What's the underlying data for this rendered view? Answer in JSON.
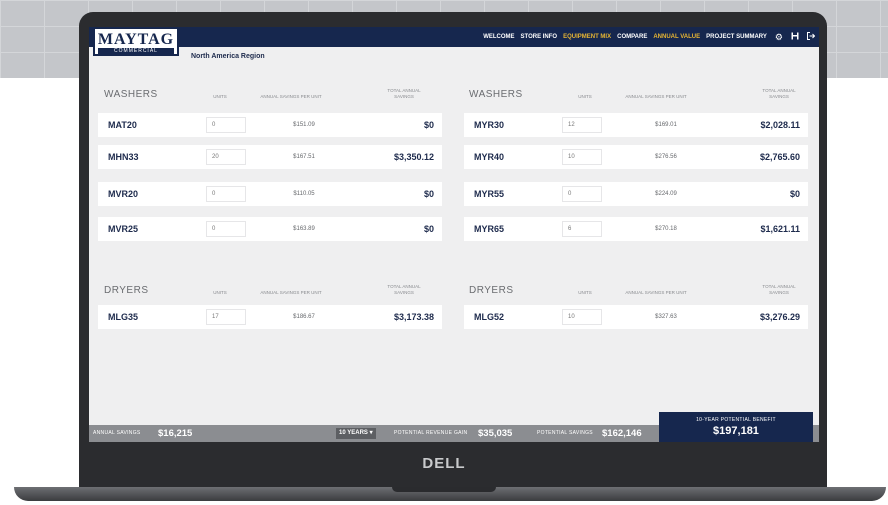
{
  "brand": {
    "name": "MAYTAG",
    "sub": "COMMERCIAL",
    "laptop": "DELL"
  },
  "nav": {
    "items": [
      {
        "label": "WELCOME"
      },
      {
        "label": "STORE INFO"
      },
      {
        "label": "EQUIPMENT MIX",
        "active": true
      },
      {
        "label": "COMPARE"
      },
      {
        "label": "ANNUAL VALUE",
        "active": true
      },
      {
        "label": "PROJECT SUMMARY"
      }
    ],
    "icons": [
      "gear-icon",
      "save-icon",
      "logout-icon"
    ]
  },
  "region": "North America Region",
  "headers": {
    "washers": "WASHERS",
    "dryers": "DRYERS",
    "units": "UNITS",
    "per_unit": "ANNUAL SAVINGS PER UNIT",
    "total": "TOTAL ANNUAL SAVINGS"
  },
  "washers_left": [
    {
      "model": "MAT20",
      "units": "0",
      "per_unit": "$151.09",
      "total": "$0"
    },
    {
      "model": "MHN33",
      "units": "20",
      "per_unit": "$167.51",
      "total": "$3,350.12"
    },
    {
      "model": "MVR20",
      "units": "0",
      "per_unit": "$110.05",
      "total": "$0"
    },
    {
      "model": "MVR25",
      "units": "0",
      "per_unit": "$163.89",
      "total": "$0"
    }
  ],
  "washers_right": [
    {
      "model": "MYR30",
      "units": "12",
      "per_unit": "$169.01",
      "total": "$2,028.11"
    },
    {
      "model": "MYR40",
      "units": "10",
      "per_unit": "$276.56",
      "total": "$2,765.60"
    },
    {
      "model": "MYR55",
      "units": "0",
      "per_unit": "$224.09",
      "total": "$0"
    },
    {
      "model": "MYR65",
      "units": "6",
      "per_unit": "$270.18",
      "total": "$1,621.11"
    }
  ],
  "dryers_left": [
    {
      "model": "MLG35",
      "units": "17",
      "per_unit": "$186.67",
      "total": "$3,173.38"
    }
  ],
  "dryers_right": [
    {
      "model": "MLG52",
      "units": "10",
      "per_unit": "$327.63",
      "total": "$3,276.29"
    }
  ],
  "footer": {
    "annual_label": "ANNUAL SAVINGS",
    "annual_value": "$16,215",
    "period": "10 YEARS",
    "revenue_label": "POTENTIAL REVENUE GAIN",
    "revenue_value": "$35,035",
    "savings_label": "POTENTIAL SAVINGS",
    "savings_value": "$162,146",
    "benefit_label": "10-YEAR POTENTIAL BENEFIT",
    "benefit_value": "$197,181"
  },
  "colors": {
    "navy": "#16274e",
    "accent": "#e7b533",
    "footer": "#8b8d91"
  }
}
